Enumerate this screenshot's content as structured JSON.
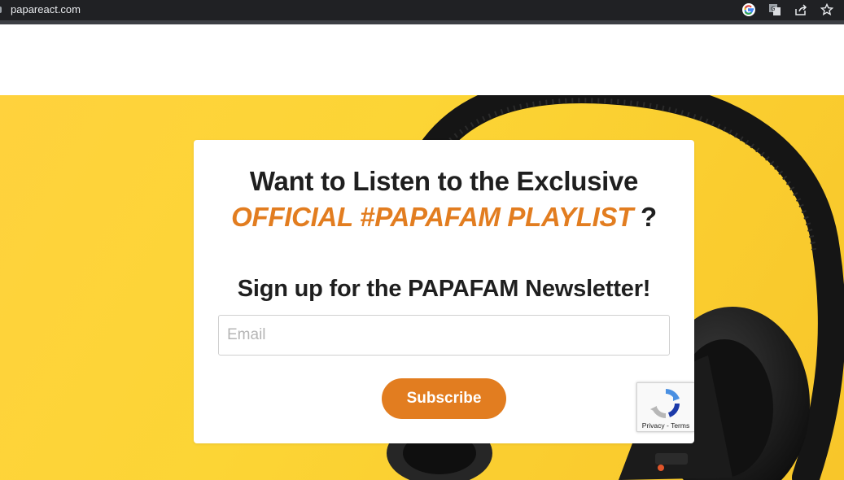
{
  "browser": {
    "url": "papareact.com",
    "icons": [
      "google-icon",
      "translate-icon",
      "share-icon",
      "star-icon"
    ]
  },
  "card": {
    "headline_line1": "Want to Listen to the Exclusive",
    "headline_accent": "OFFICIAL #PAPAFAM PLAYLIST",
    "headline_suffix": "?",
    "subheading": "Sign up for the PAPAFAM Newsletter!",
    "email_placeholder": "Email",
    "email_value": "",
    "subscribe_label": "Subscribe"
  },
  "recaptcha": {
    "privacy_label": "Privacy",
    "separator": " - ",
    "terms_label": "Terms"
  },
  "colors": {
    "accent": "#e27d20",
    "background_yellow": "#fcd535",
    "browser_bar": "#202124"
  }
}
